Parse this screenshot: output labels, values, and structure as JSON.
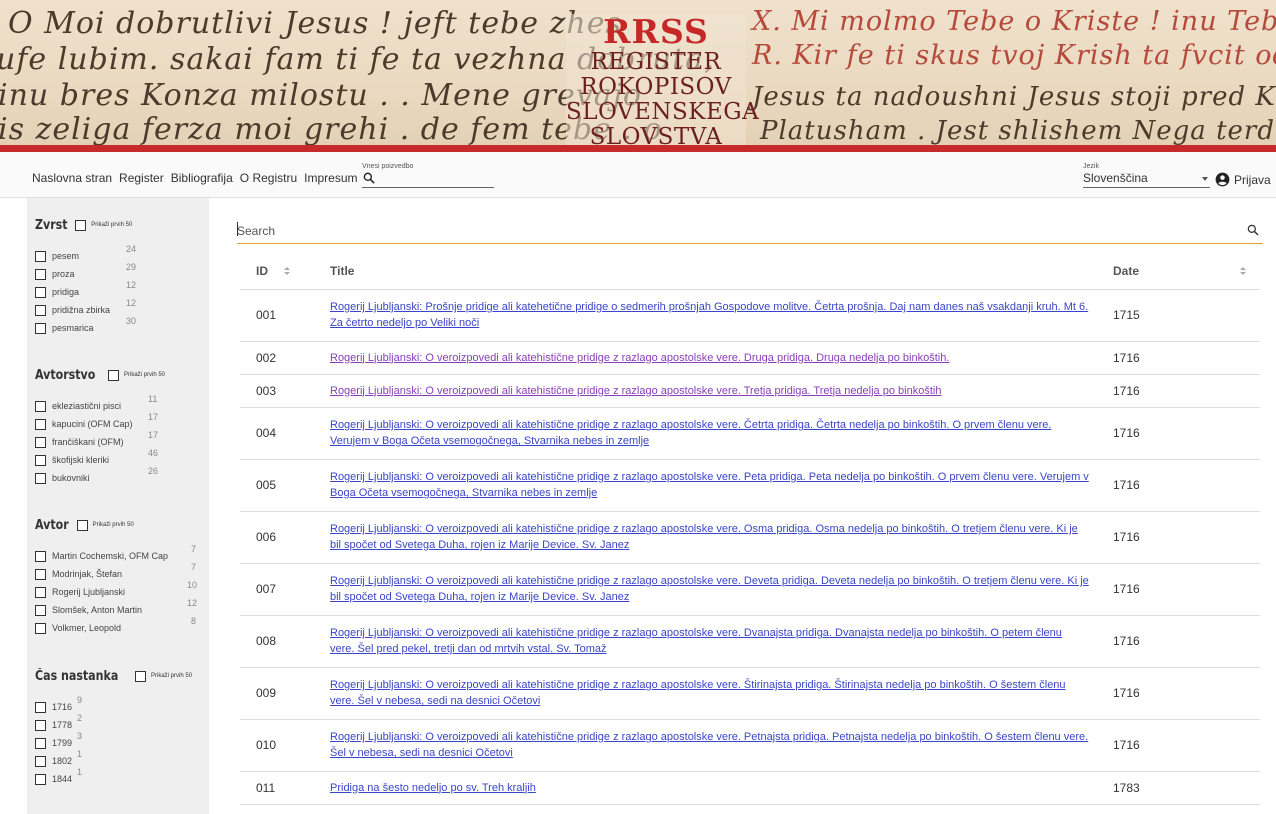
{
  "banner": {
    "handwriting": [
      "O Moi dobrutlivi Jesus ! jeft tebe zhes",
      "ufe lubim. sakai fam ti fe ta vezhna dobruta,",
      "inu bres Konza milostu . . Mene grevajo",
      "is zeliga ferza moi grehi . de fem tebe . o",
      "X. Mi molmo Tebe o Kriste ! inu Tebe hualmo !",
      "R. Kir fe ti skus tvoj Krish ta fvcit odrishou !",
      "Jesus ta nadoushni Jesus stoji pred Kervishnem",
      "Platusham . Jest shlishem Nega terdu tosht od Ju"
    ],
    "logo": {
      "abbr": "RRSS",
      "line1": "REGISTER",
      "line2": "ROKOPISOV",
      "line3": "SLOVENSKEGA",
      "line4": "SLOVSTVA"
    }
  },
  "nav": {
    "links": [
      "Naslovna stran",
      "Register",
      "Bibliografija",
      "O Registru",
      "Impresum"
    ],
    "search_label": "Vnesi poizvedbo",
    "language_label": "Jezik",
    "language_value": "Slovenščina",
    "login_label": "Prijava"
  },
  "facets": [
    {
      "title": "Zvrst",
      "first50": "Prikaži prvih 50",
      "items": [
        {
          "label": "pesem",
          "count": "24"
        },
        {
          "label": "proza",
          "count": "29"
        },
        {
          "label": "pridiga",
          "count": "12"
        },
        {
          "label": "pridižna zbirka",
          "count": "12"
        },
        {
          "label": "pesmarica",
          "count": "30"
        }
      ]
    },
    {
      "title": "Avtorstvo",
      "first50": "Prikaži prvih 50",
      "items": [
        {
          "label": "ekleziastični pisci",
          "count": "11"
        },
        {
          "label": "kapucini (OFM Cap)",
          "count": "17"
        },
        {
          "label": "frančiškani (OFM)",
          "count": "17"
        },
        {
          "label": "škofijski kleriki",
          "count": "46"
        },
        {
          "label": "bukovniki",
          "count": "26"
        }
      ]
    },
    {
      "title": "Avtor",
      "first50": "Prikaži prvih 50",
      "items": [
        {
          "label": "Martin Cochemski, OFM Cap",
          "count": "7"
        },
        {
          "label": "Modrinjak, Štefan",
          "count": "7"
        },
        {
          "label": "Rogerij Ljubljanski",
          "count": "10"
        },
        {
          "label": "Slomšek, Anton Martin",
          "count": "12"
        },
        {
          "label": "Volkmer, Leopold",
          "count": "8"
        }
      ]
    },
    {
      "title": "Čas nastanka",
      "first50": "Prikaži prvih 50",
      "items": [
        {
          "label": "1716",
          "count": "9"
        },
        {
          "label": "1778",
          "count": "2"
        },
        {
          "label": "1799",
          "count": "3"
        },
        {
          "label": "1802",
          "count": "1"
        },
        {
          "label": "1844",
          "count": "1"
        }
      ]
    }
  ],
  "table": {
    "search_placeholder": "Search",
    "headers": {
      "id": "ID",
      "title": "Title",
      "date": "Date"
    },
    "rows": [
      {
        "id": "001",
        "title": "Rogerij Ljubljanski: Prošnje pridige ali katehetične pridige o sedmerih prošnjah Gospodove molitve. Četrta prošnja. Daj nam danes naš vsakdanji kruh. Mt 6. Za četrto nedeljo po Veliki noči",
        "date": "1715",
        "visited": false,
        "lines": 2
      },
      {
        "id": "002",
        "title": "Rogerij Ljubljanski: O veroizpovedi ali katehistične pridige z razlago apostolske vere. Druga pridiga. Druga nedelja po binkoštih.",
        "date": "1716",
        "visited": true,
        "lines": 1
      },
      {
        "id": "003",
        "title": "Rogerij Ljubljanski: O veroizpovedi ali katehistične pridige z razlago apostolske vere. Tretja pridiga. Tretja nedelja po binkoštih",
        "date": "1716",
        "visited": true,
        "lines": 1
      },
      {
        "id": "004",
        "title": "Rogerij Ljubljanski: O veroizpovedi ali katehistične pridige z razlago apostolske vere. Četrta pridiga. Četrta nedelja po binkoštih. O prvem členu vere. Verujem v Boga Očeta vsemogočnega, Stvarnika nebes in zemlje",
        "date": "1716",
        "visited": false,
        "lines": 2
      },
      {
        "id": "005",
        "title": "Rogerij Ljubljanski: O veroizpovedi ali katehistične pridige z razlago apostolske vere. Peta pridiga. Peta nedelja po binkoštih. O prvem členu vere. Verujem v Boga Očeta vsemogočnega, Stvarnika nebes in zemlje",
        "date": "1716",
        "visited": false,
        "lines": 2
      },
      {
        "id": "006",
        "title": "Rogerij Ljubljanski: O veroizpovedi ali katehistične pridige z razlago apostolske vere. Osma pridiga. Osma nedelja po binkoštih. O tretjem členu vere. Ki je bil spočet od Svetega Duha, rojen iz Marije Device. Sv. Janez",
        "date": "1716",
        "visited": false,
        "lines": 2
      },
      {
        "id": "007",
        "title": "Rogerij Ljubljanski: O veroizpovedi ali katehistične pridige z razlago apostolske vere. Deveta pridiga. Deveta nedelja po binkoštih. O tretjem členu vere. Ki je bil spočet od Svetega Duha, rojen iz Marije Device. Sv. Janez",
        "date": "1716",
        "visited": false,
        "lines": 2
      },
      {
        "id": "008",
        "title": "Rogerij Ljubljanski: O veroizpovedi ali katehistične pridige z razlago apostolske vere. Dvanajsta pridiga. Dvanajsta nedelja po binkoštih. O petem členu vere. Šel pred pekel, tretji dan od mrtvih vstal. Sv. Tomaž",
        "date": "1716",
        "visited": false,
        "lines": 2
      },
      {
        "id": "009",
        "title": "Rogerij Ljubljanski: O veroizpovedi ali katehistične pridige z razlago apostolske vere. Štirinajsta pridiga. Štirinajsta nedelja po binkoštih. O šestem členu vere. Šel v nebesa, sedi na desnici Očetovi",
        "date": "1716",
        "visited": false,
        "lines": 2
      },
      {
        "id": "010",
        "title": "Rogerij Ljubljanski: O veroizpovedi ali katehistične pridige z razlago apostolske vere. Petnajsta pridiga. Petnajsta nedelja po binkoštih. O šestem členu vere. Šel v nebesa, sedi na desnici Očetovi",
        "date": "1716",
        "visited": false,
        "lines": 2
      },
      {
        "id": "011",
        "title": "Pridiga na šesto nedeljo po sv. Treh kraljih",
        "date": "1783",
        "visited": false,
        "lines": 1
      }
    ]
  },
  "colors": {
    "brand_red": "#c62828",
    "link": "#3a46c7",
    "link_visited": "#8a3fb8",
    "search_underline": "#e0a52a",
    "sidebar_bg": "#efefef"
  },
  "icons": {
    "search": "search-icon",
    "account": "account-circle-icon",
    "sort": "sort-icon",
    "dropdown": "chevron-down-icon",
    "checkbox": "checkbox-icon"
  }
}
